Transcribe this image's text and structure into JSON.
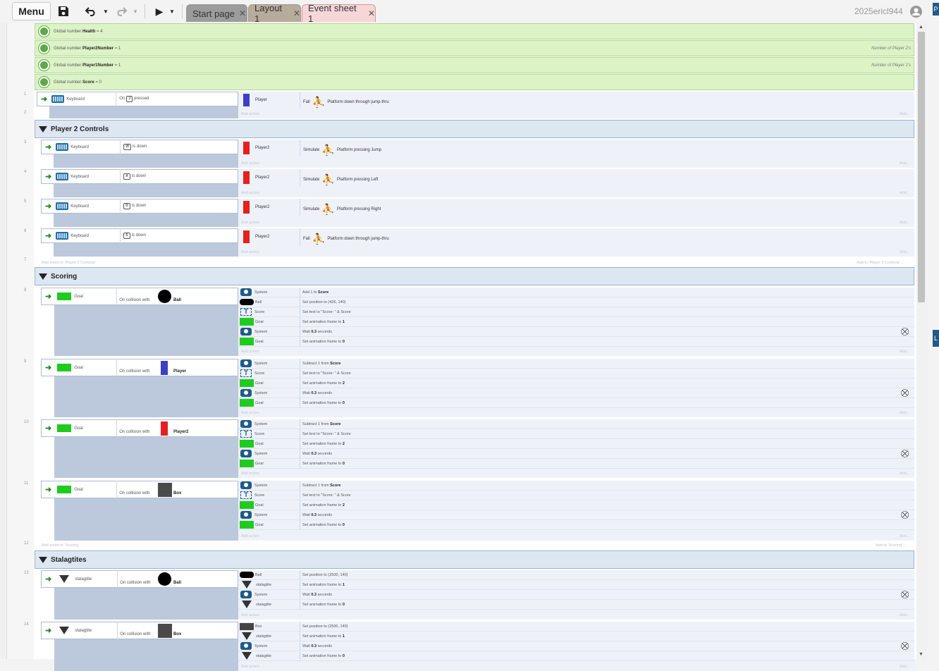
{
  "toolbar": {
    "menu_label": "Menu",
    "user_name": "2025ericl944"
  },
  "tabs": [
    {
      "label": "Start page"
    },
    {
      "label": "Layout 1"
    },
    {
      "label": "Event sheet 1"
    }
  ],
  "right_panel_letters": {
    "a": "P",
    "b": "L"
  },
  "globals": [
    {
      "prefix": "Global number",
      "name": "Health",
      "value": "= 4",
      "comment": ""
    },
    {
      "prefix": "Global number",
      "name": "Player2Number",
      "value": "= 1",
      "comment": "Number of Player 2's"
    },
    {
      "prefix": "Global number",
      "name": "Player1Number",
      "value": "= 1",
      "comment": "Number of Player 1's"
    },
    {
      "prefix": "Global number",
      "name": "Score",
      "value": "= 0",
      "comment": ""
    }
  ],
  "line_numbers": [
    "1",
    "2",
    "3",
    "4",
    "5",
    "6",
    "7",
    "8",
    "9",
    "10",
    "11",
    "12",
    "13",
    "14"
  ],
  "common": {
    "add_action": "Add action",
    "add_more": "Add...",
    "wait_icon": "wait-icon"
  },
  "event1": {
    "obj": "Keyboard",
    "cond_pre": "On",
    "key": "J",
    "cond_post": "pressed",
    "act_obj": "Player",
    "act_verb": "Fall",
    "behavior": "Platform down through jump-thru"
  },
  "group_p2": {
    "title": "Player 2 Controls",
    "add_event": "Add event to 'Player 2 Controls'",
    "add_to": "Add to 'Player 2 Controls'..."
  },
  "p2_events": [
    {
      "obj": "Keyboard",
      "key": "W",
      "cond": "is down",
      "act_obj": "Player2",
      "act_verb": "Simulate",
      "behavior": "Platform pressing Jump"
    },
    {
      "obj": "Keyboard",
      "key": "A",
      "cond": "is down",
      "act_obj": "Player2",
      "act_verb": "Simulate",
      "behavior": "Platform pressing Left"
    },
    {
      "obj": "Keyboard",
      "key": "D",
      "cond": "is down",
      "act_obj": "Player2",
      "act_verb": "Simulate",
      "behavior": "Platform pressing Right"
    },
    {
      "obj": "Keyboard",
      "key": "S",
      "cond": "is down",
      "act_obj": "Player2",
      "act_verb": "Fall",
      "behavior": "Platform down through jump-thru"
    }
  ],
  "group_scoring": {
    "title": "Scoring",
    "add_event": "Add event to 'Scoring'",
    "add_to": "Add to 'Scoring'..."
  },
  "scoring_events": [
    {
      "obj": "Goal",
      "cond": "On collision with",
      "target": "Ball",
      "actions": [
        {
          "obj": "System",
          "pre": "Add 1 to ",
          "bold": "Score",
          "post": ""
        },
        {
          "obj": "Ball",
          "pre": "Set position to (426, 140)",
          "bold": "",
          "post": ""
        },
        {
          "obj": "Score",
          "pre": "Set text to \"Score: \" & Score",
          "bold": "",
          "post": ""
        },
        {
          "obj": "Goal",
          "pre": "Set animation frame to ",
          "bold": "1",
          "post": ""
        },
        {
          "obj": "System",
          "pre": "Wait ",
          "bold": "0.3",
          "post": " seconds"
        },
        {
          "obj": "Goal",
          "pre": "Set animation frame to ",
          "bold": "0",
          "post": ""
        }
      ]
    },
    {
      "obj": "Goal",
      "cond": "On collision with",
      "target": "Player",
      "actions": [
        {
          "obj": "System",
          "pre": "Subtract 1 from ",
          "bold": "Score",
          "post": ""
        },
        {
          "obj": "Score",
          "pre": "Set text to \"Score: \" & Score",
          "bold": "",
          "post": ""
        },
        {
          "obj": "Goal",
          "pre": "Set animation frame to ",
          "bold": "2",
          "post": ""
        },
        {
          "obj": "System",
          "pre": "Wait ",
          "bold": "0.3",
          "post": " seconds"
        },
        {
          "obj": "Goal",
          "pre": "Set animation frame to ",
          "bold": "0",
          "post": ""
        }
      ]
    },
    {
      "obj": "Goal",
      "cond": "On collision with",
      "target": "Player2",
      "actions": [
        {
          "obj": "System",
          "pre": "Subtract 1 from ",
          "bold": "Score",
          "post": ""
        },
        {
          "obj": "Score",
          "pre": "Set text to \"Score: \" & Score",
          "bold": "",
          "post": ""
        },
        {
          "obj": "Goal",
          "pre": "Set animation frame to ",
          "bold": "2",
          "post": ""
        },
        {
          "obj": "System",
          "pre": "Wait ",
          "bold": "0.3",
          "post": " seconds"
        },
        {
          "obj": "Goal",
          "pre": "Set animation frame to ",
          "bold": "0",
          "post": ""
        }
      ]
    },
    {
      "obj": "Goal",
      "cond": "On collision with",
      "target": "Box",
      "actions": [
        {
          "obj": "System",
          "pre": "Subtract 1 from ",
          "bold": "Score",
          "post": ""
        },
        {
          "obj": "Score",
          "pre": "Set text to \"Score: \" & Score",
          "bold": "",
          "post": ""
        },
        {
          "obj": "Goal",
          "pre": "Set animation frame to ",
          "bold": "2",
          "post": ""
        },
        {
          "obj": "System",
          "pre": "Wait ",
          "bold": "0.3",
          "post": " seconds"
        },
        {
          "obj": "Goal",
          "pre": "Set animation frame to ",
          "bold": "0",
          "post": ""
        }
      ]
    }
  ],
  "group_stal": {
    "title": "Stalagtites"
  },
  "stal_events": [
    {
      "obj": "stalagtite",
      "cond": "On collision with",
      "target": "Ball",
      "actions": [
        {
          "obj": "Ball",
          "pre": "Set position to (2500, 140)",
          "bold": "",
          "post": ""
        },
        {
          "obj": "stalagtite",
          "pre": "Set animation frame to ",
          "bold": "1",
          "post": ""
        },
        {
          "obj": "System",
          "pre": "Wait ",
          "bold": "0.3",
          "post": " seconds"
        },
        {
          "obj": "stalagtite",
          "pre": "Set animation frame to ",
          "bold": "0",
          "post": ""
        }
      ]
    },
    {
      "obj": "stalagtite",
      "cond": "On collision with",
      "target": "Box",
      "actions": [
        {
          "obj": "Box",
          "pre": "Set position to (2500, 140)",
          "bold": "",
          "post": ""
        },
        {
          "obj": "stalagtite",
          "pre": "Set animation frame to ",
          "bold": "1",
          "post": ""
        },
        {
          "obj": "System",
          "pre": "Wait ",
          "bold": "0.3",
          "post": " seconds"
        },
        {
          "obj": "stalagtite",
          "pre": "Set animation frame to ",
          "bold": "0",
          "post": ""
        }
      ]
    }
  ]
}
